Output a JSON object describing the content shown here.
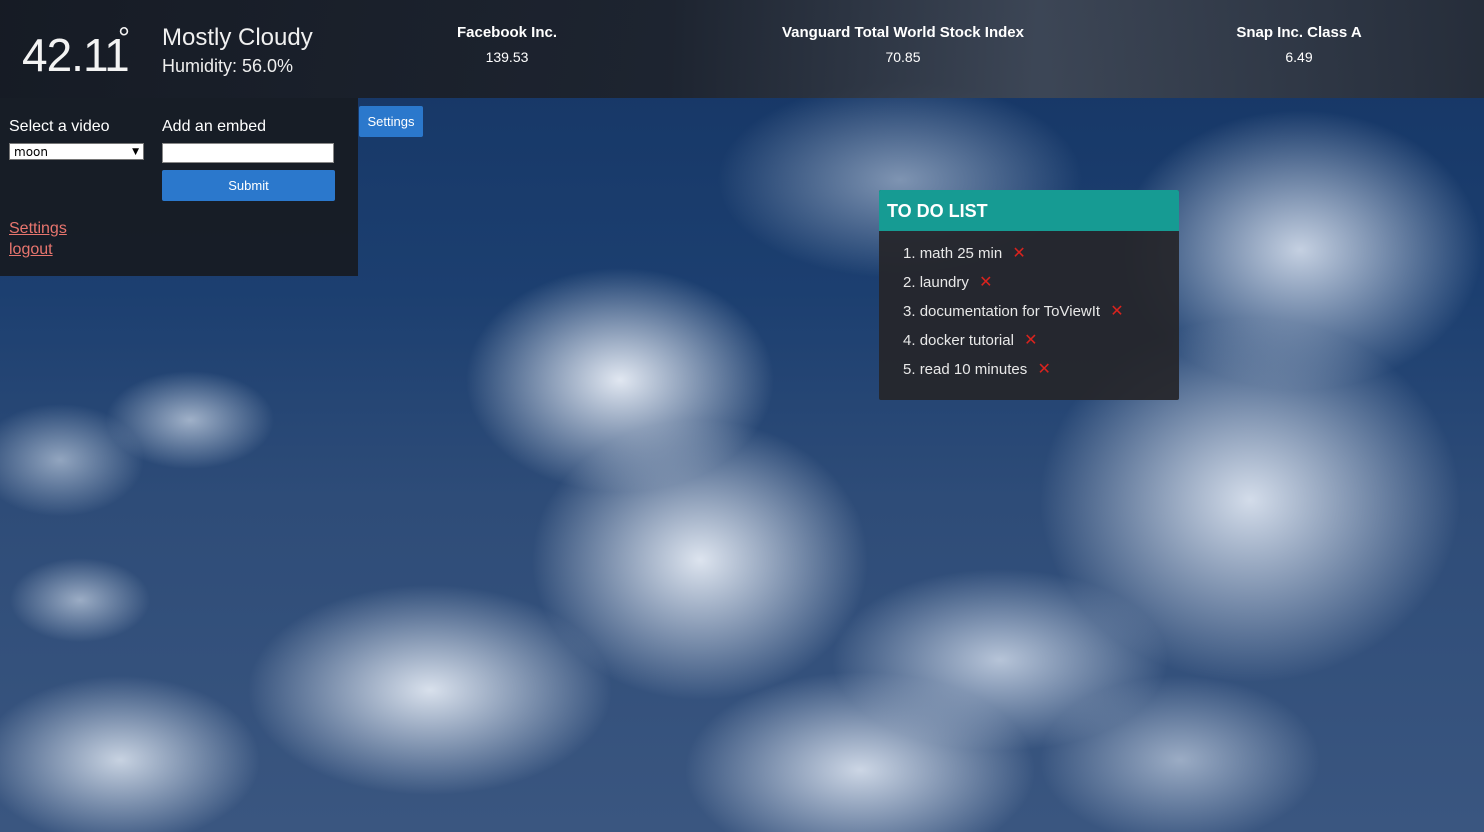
{
  "weather": {
    "temperature": "42.11",
    "degree_symbol": "°",
    "condition": "Mostly Cloudy",
    "humidity": "Humidity: 56.0%"
  },
  "stocks": [
    {
      "name": "Facebook Inc.",
      "price": "139.53"
    },
    {
      "name": "Vanguard Total World Stock Index",
      "price": "70.85"
    },
    {
      "name": "Snap Inc. Class A",
      "price": "6.49"
    }
  ],
  "video_panel": {
    "select_label": "Select a video",
    "selected_video": "moon",
    "embed_label": "Add an embed",
    "embed_value": "",
    "submit_label": "Submit",
    "settings_link": "Settings",
    "logout_link": "logout"
  },
  "settings_button": "Settings",
  "todo": {
    "title": "TO DO LIST",
    "items": [
      {
        "index": "1.",
        "text": "math 25 min"
      },
      {
        "index": "2.",
        "text": "laundry"
      },
      {
        "index": "3.",
        "text": "documentation for ToViewIt"
      },
      {
        "index": "4.",
        "text": "docker tutorial"
      },
      {
        "index": "5.",
        "text": "read 10 minutes"
      }
    ],
    "delete_glyph": "✕"
  },
  "colors": {
    "accent_button": "#2b78cc",
    "todo_header": "#169b93",
    "link": "#e8756e",
    "delete": "#d9231e"
  },
  "icons": {
    "dropdown": "chevron-down-icon",
    "delete": "close-icon"
  }
}
